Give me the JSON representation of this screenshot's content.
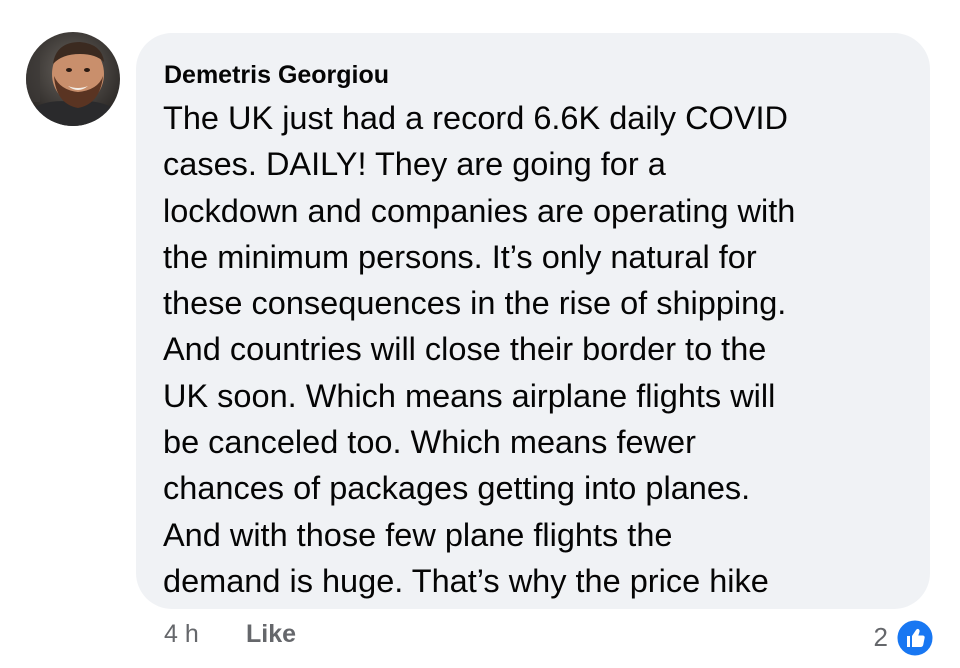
{
  "comment": {
    "author": "Demetris Georgiou",
    "text_lines": [
      "The UK just had a record 6.6K daily COVID",
      "cases. DAILY! They are going for a",
      "lockdown and companies are operating with",
      "the minimum persons. It’s only natural for",
      "these consequences in the rise of shipping.",
      "And countries will close their border to the",
      "UK soon. Which means airplane flights will",
      "be canceled too. Which means fewer",
      "chances of packages getting into planes.",
      "And with those few plane flights the",
      "demand is huge. That’s why the price hike"
    ]
  },
  "footer": {
    "timestamp": "4 h",
    "like_label": "Like",
    "reaction_count": "2",
    "reaction_icon": "thumbs-up-icon"
  },
  "colors": {
    "bubble_bg": "#f0f2f5",
    "text": "#050505",
    "secondary_text": "#65676b",
    "like_blue": "#1877f2"
  }
}
